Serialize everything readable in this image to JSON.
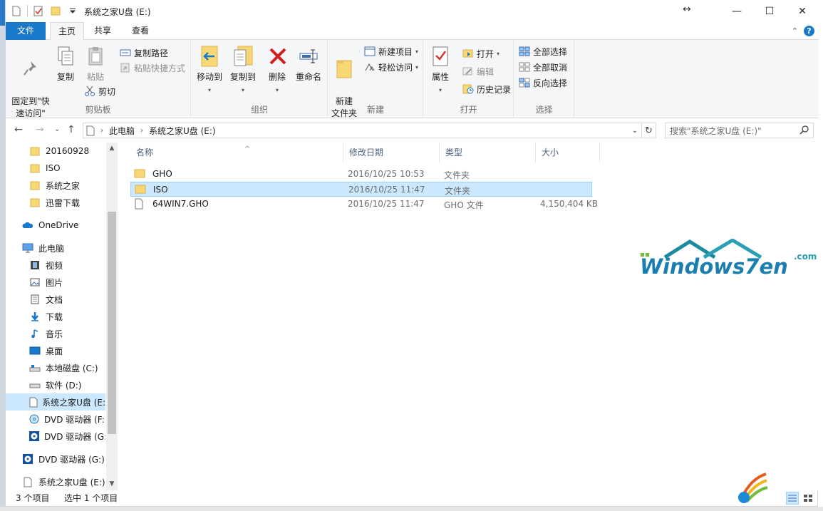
{
  "window": {
    "title": "系统之家U盘 (E:)",
    "controls": {
      "minimize": "—",
      "maximize": "☐",
      "close": "✕"
    }
  },
  "tabs": [
    {
      "label": "文件"
    },
    {
      "label": "主页"
    },
    {
      "label": "共享"
    },
    {
      "label": "查看"
    }
  ],
  "ribbon": {
    "clipboard": {
      "label": "剪贴板",
      "pin_label": "固定到\"快\n速访问\"",
      "copy_label": "复制",
      "paste_label": "粘贴",
      "copy_path_label": "复制路径",
      "paste_shortcut_label": "粘贴快捷方式",
      "cut_label": "剪切"
    },
    "organize": {
      "label": "组织",
      "move_to_label": "移动到",
      "copy_to_label": "复制到",
      "delete_label": "删除",
      "rename_label": "重命名"
    },
    "new": {
      "label": "新建",
      "new_folder_label": "新建\n文件夹",
      "new_item_label": "新建项目",
      "easy_access_label": "轻松访问"
    },
    "open": {
      "label": "打开",
      "properties_label": "属性",
      "open_label": "打开",
      "edit_label": "编辑",
      "history_label": "历史记录"
    },
    "select": {
      "label": "选择",
      "select_all_label": "全部选择",
      "select_none_label": "全部取消",
      "invert_label": "反向选择"
    }
  },
  "address": {
    "crumbs": [
      "此电脑",
      "系统之家U盘 (E:)"
    ],
    "search_placeholder": "搜索\"系统之家U盘 (E:)\""
  },
  "nav": {
    "items": [
      {
        "label": "20160928",
        "icon": "folder-icon"
      },
      {
        "label": "ISO",
        "icon": "folder-icon"
      },
      {
        "label": "系统之家",
        "icon": "folder-icon"
      },
      {
        "label": "迅雷下载",
        "icon": "folder-icon"
      },
      {
        "label": "OneDrive",
        "icon": "cloud-icon"
      },
      {
        "label": "此电脑",
        "icon": "computer-icon"
      },
      {
        "label": "视频",
        "icon": "video-icon"
      },
      {
        "label": "图片",
        "icon": "picture-icon"
      },
      {
        "label": "文档",
        "icon": "document-icon"
      },
      {
        "label": "下载",
        "icon": "download-icon"
      },
      {
        "label": "音乐",
        "icon": "music-icon"
      },
      {
        "label": "桌面",
        "icon": "desktop-icon"
      },
      {
        "label": "本地磁盘 (C:)",
        "icon": "drive-icon"
      },
      {
        "label": "软件 (D:)",
        "icon": "drive-icon"
      },
      {
        "label": "系统之家U盘 (E:",
        "icon": "usb-drive-icon"
      },
      {
        "label": "DVD 驱动器 (F:)",
        "icon": "dvd-icon"
      },
      {
        "label": "DVD 驱动器 (G:",
        "icon": "dvd-icon"
      },
      {
        "label": "DVD 驱动器 (G:)",
        "icon": "dvd-icon"
      },
      {
        "label": "系统之家U盘 (E:)",
        "icon": "usb-drive-icon"
      }
    ]
  },
  "files": {
    "columns": [
      "名称",
      "修改日期",
      "类型",
      "大小"
    ],
    "rows": [
      {
        "name": "GHO",
        "date": "2016/10/25 10:53",
        "type": "文件夹",
        "size": ""
      },
      {
        "name": "ISO",
        "date": "2016/10/25 11:47",
        "type": "文件夹",
        "size": ""
      },
      {
        "name": "64WIN7.GHO",
        "date": "2016/10/25 11:47",
        "type": "GHO 文件",
        "size": "4,150,404 KB"
      }
    ]
  },
  "status": {
    "count": "3 个项目",
    "selected": "选中 1 个项目"
  },
  "watermark": {
    "text": "Windows7en",
    "suffix": ".com"
  },
  "colors": {
    "accent": "#1979ca",
    "selection": "#cce8ff",
    "folder": "#f8d775"
  }
}
